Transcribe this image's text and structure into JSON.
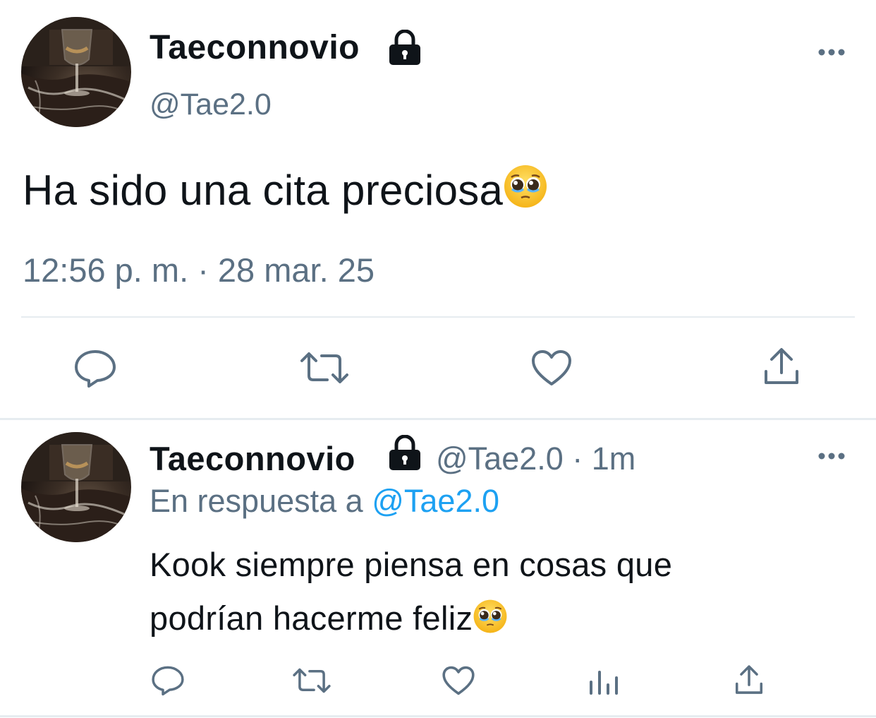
{
  "main_tweet": {
    "author": {
      "display_name": "Taeconnovio",
      "handle": "@Tae2.0",
      "protected_icon": "lock-icon",
      "avatar": "wine-glass-photo"
    },
    "text": "Ha sido una cita preciosa",
    "emoji": "pleading-face",
    "timestamp": "12:56 p. m. · 28 mar. 25",
    "menu_icon": "more-icon",
    "actions": [
      "reply-icon",
      "retweet-icon",
      "like-icon",
      "share-icon"
    ]
  },
  "reply_tweet": {
    "author": {
      "display_name": "Taeconnovio",
      "handle_and_time": "@Tae2.0 · 1m",
      "protected_icon": "lock-icon",
      "avatar": "wine-glass-photo"
    },
    "in_reply_to_prefix": "En respuesta a",
    "in_reply_to_handle": "@Tae2.0",
    "text_line1": "Kook siempre piensa en cosas que",
    "text_line2": "podrían hacerme feliz",
    "emoji": "pleading-face",
    "menu_icon": "more-icon",
    "actions": [
      "reply-icon",
      "retweet-icon",
      "like-icon",
      "analytics-icon",
      "share-icon"
    ]
  },
  "colors": {
    "text": "#0f1419",
    "secondary": "#5b7083",
    "link": "#1da1f2",
    "divider": "#e6ecf0"
  }
}
